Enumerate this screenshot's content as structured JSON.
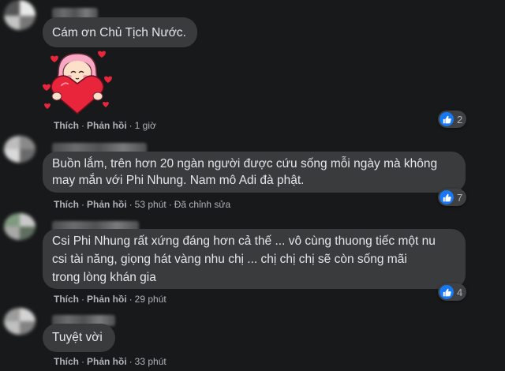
{
  "comments": [
    {
      "text": "Cám ơn Chủ Tịch Nước.",
      "actions": {
        "like": "Thích",
        "reply": "Phản hồi",
        "time": "1 giờ"
      },
      "reactions": "2"
    },
    {
      "text_lines": [
        "Buồn lắm, trên hơn 20 ngàn người được cứu sống mỗi ngày mà không",
        "may mắn với Phi Nhung. Nam mô Adi đà phật."
      ],
      "actions": {
        "like": "Thích",
        "reply": "Phản hồi",
        "time": "53 phút",
        "edited": "Đã chỉnh sửa"
      },
      "reactions": "7"
    },
    {
      "text_lines": [
        "Csi Phi Nhung rất xứng đáng hơn cả thế ... vô cùng thuong tiếc một nu",
        "csi tài năng, giọng hát vàng nhu chị ... chị chị chị sẽ còn sống mãi",
        "trong lòng khán gia"
      ],
      "actions": {
        "like": "Thích",
        "reply": "Phản hồi",
        "time": "29 phút"
      },
      "reactions": "4"
    },
    {
      "text": "Tuyệt vời",
      "actions": {
        "like": "Thích",
        "reply": "Phản hồi",
        "time": "33 phút"
      }
    }
  ],
  "sticker": {
    "name": "girl-hugging-heart-sticker"
  },
  "icons": {
    "reaction": "like-icon"
  },
  "colors": {
    "background": "#18191a",
    "bubble": "#3a3b3c",
    "like_blue": "#1877f2"
  }
}
